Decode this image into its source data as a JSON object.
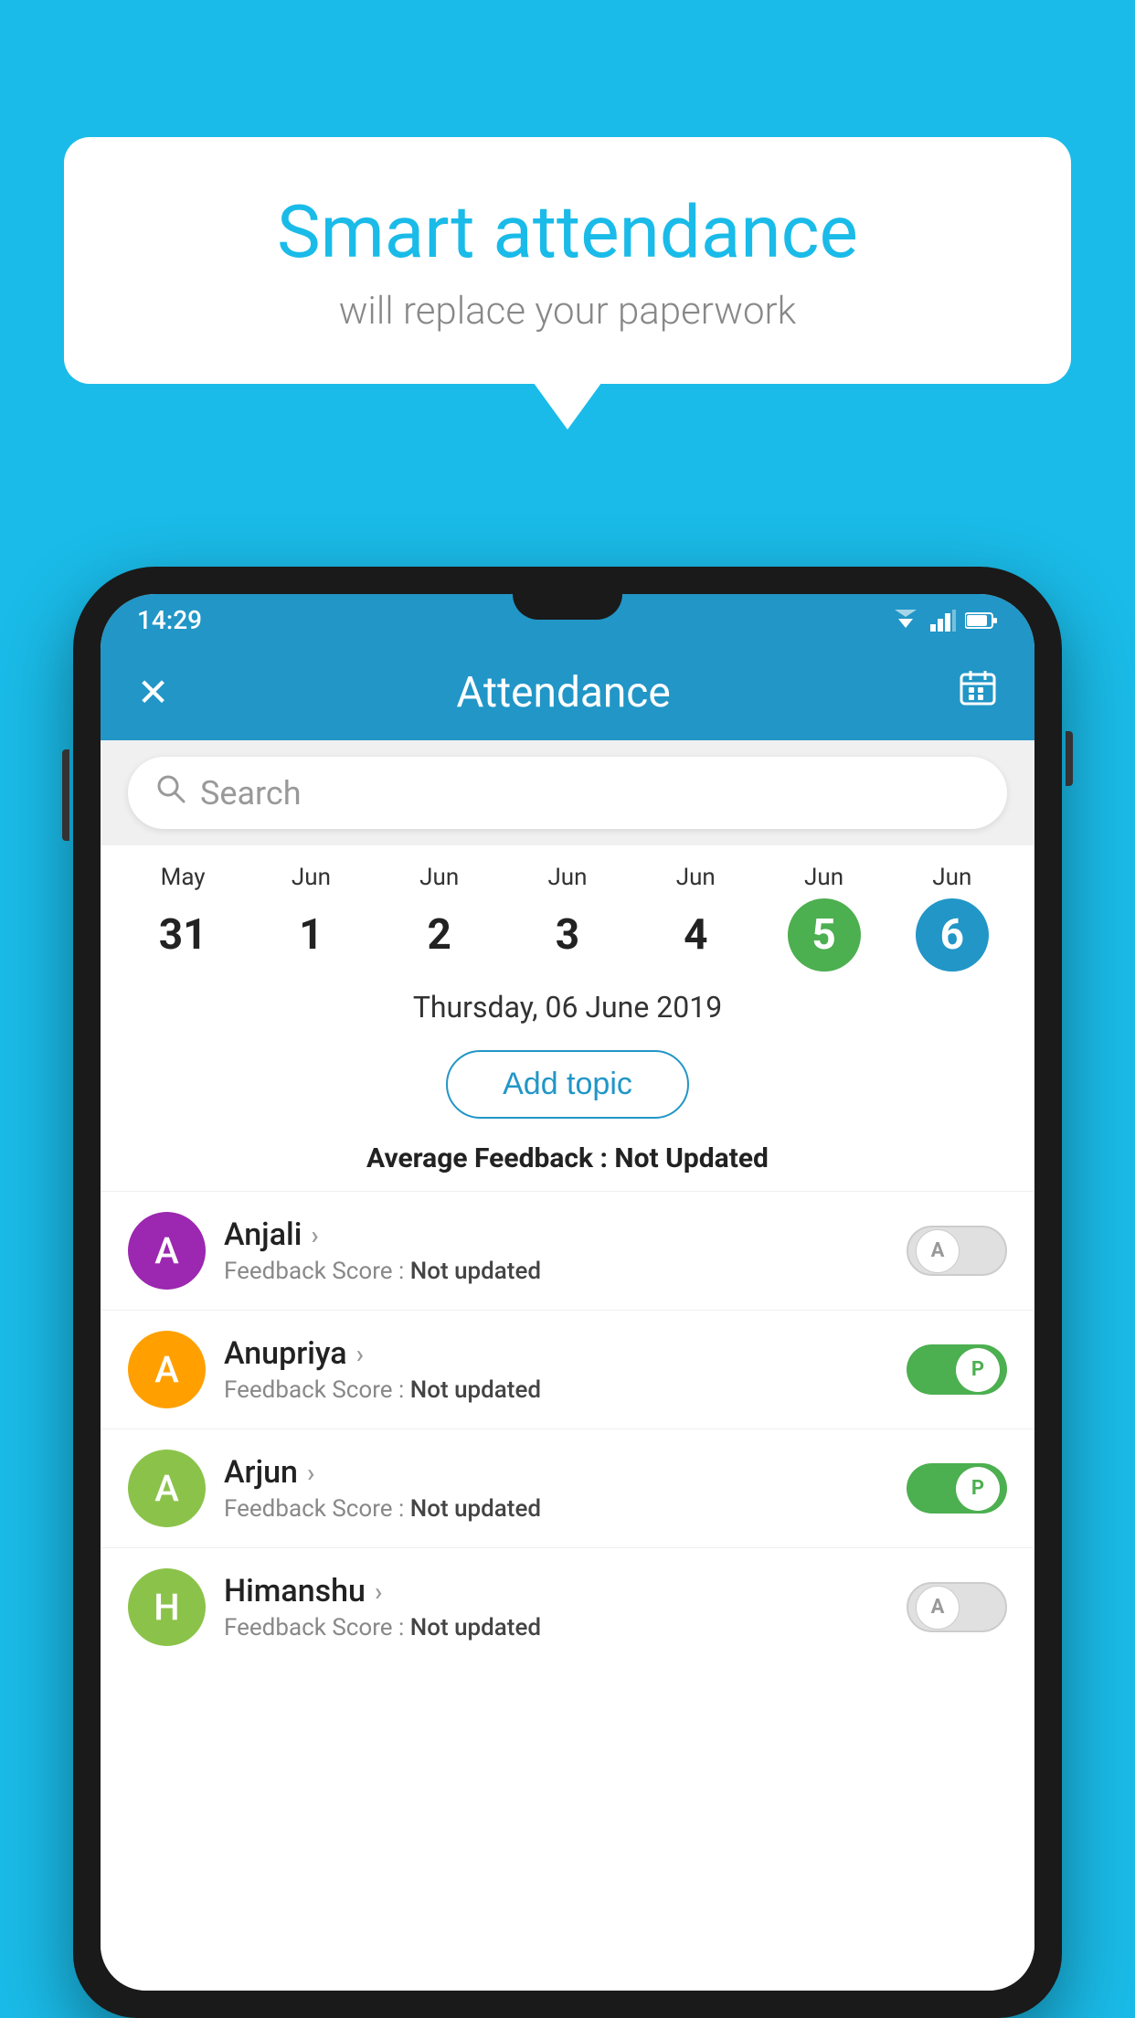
{
  "background": {
    "color": "#1ABBE8"
  },
  "bubble": {
    "title": "Smart attendance",
    "subtitle": "will replace your paperwork"
  },
  "statusBar": {
    "time": "14:29"
  },
  "appBar": {
    "title": "Attendance",
    "closeIcon": "✕",
    "calendarIcon": "📅"
  },
  "search": {
    "placeholder": "Search"
  },
  "calendar": {
    "days": [
      {
        "month": "May",
        "date": "31",
        "state": "normal"
      },
      {
        "month": "Jun",
        "date": "1",
        "state": "normal"
      },
      {
        "month": "Jun",
        "date": "2",
        "state": "normal"
      },
      {
        "month": "Jun",
        "date": "3",
        "state": "normal"
      },
      {
        "month": "Jun",
        "date": "4",
        "state": "normal"
      },
      {
        "month": "Jun",
        "date": "5",
        "state": "today"
      },
      {
        "month": "Jun",
        "date": "6",
        "state": "selected"
      }
    ]
  },
  "selectedDate": "Thursday, 06 June 2019",
  "addTopicLabel": "Add topic",
  "avgFeedbackLabel": "Average Feedback :",
  "avgFeedbackValue": "Not Updated",
  "students": [
    {
      "name": "Anjali",
      "avatarColor": "#9C27B0",
      "avatarLetter": "A",
      "feedbackLabel": "Feedback Score :",
      "feedbackValue": "Not updated",
      "status": "absent",
      "toggleLetter": "A"
    },
    {
      "name": "Anupriya",
      "avatarColor": "#FFA000",
      "avatarLetter": "A",
      "feedbackLabel": "Feedback Score :",
      "feedbackValue": "Not updated",
      "status": "present",
      "toggleLetter": "P"
    },
    {
      "name": "Arjun",
      "avatarColor": "#8BC34A",
      "avatarLetter": "A",
      "feedbackLabel": "Feedback Score :",
      "feedbackValue": "Not updated",
      "status": "present",
      "toggleLetter": "P"
    },
    {
      "name": "Himanshu",
      "avatarColor": "#8BC34A",
      "avatarLetter": "H",
      "feedbackLabel": "Feedback Score :",
      "feedbackValue": "Not updated",
      "status": "absent",
      "toggleLetter": "A"
    }
  ]
}
